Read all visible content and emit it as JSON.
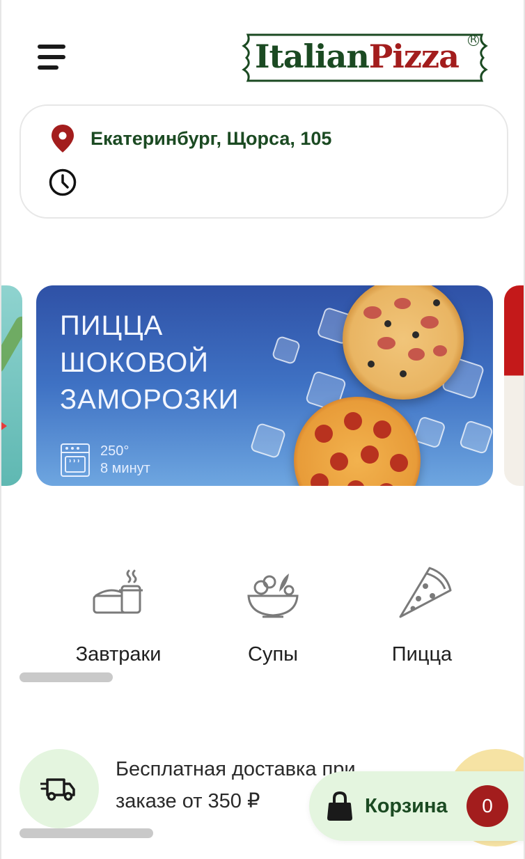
{
  "header": {
    "menu_icon": "hamburger-menu-icon",
    "logo": {
      "part1": "Italian",
      "part2": "Pizza",
      "registered": "R"
    }
  },
  "location": {
    "pin_icon": "location-pin-icon",
    "address": "Екатеринбург, Щорса, 105",
    "clock_icon": "clock-icon"
  },
  "banner": {
    "title_lines": [
      "ПИЦЦА",
      "ШОКОВОЙ",
      "ЗАМОРОЗКИ"
    ],
    "temperature": "250°",
    "time": "8 минут",
    "oven_icon": "oven-icon"
  },
  "categories": [
    {
      "label": "Завтраки",
      "icon": "breakfast-icon"
    },
    {
      "label": "Супы",
      "icon": "salad-bowl-icon"
    },
    {
      "label": "Пицца",
      "icon": "pizza-slice-icon"
    }
  ],
  "promo": {
    "text": "Бесплатная доставка при заказе от 350 ₽",
    "icon": "delivery-truck-icon"
  },
  "cart": {
    "label": "Корзина",
    "count": "0",
    "icon": "bag-lock-icon"
  },
  "colors": {
    "brand_green": "#1b4a22",
    "brand_red": "#a31d1d",
    "light_green": "#e4f5df"
  }
}
